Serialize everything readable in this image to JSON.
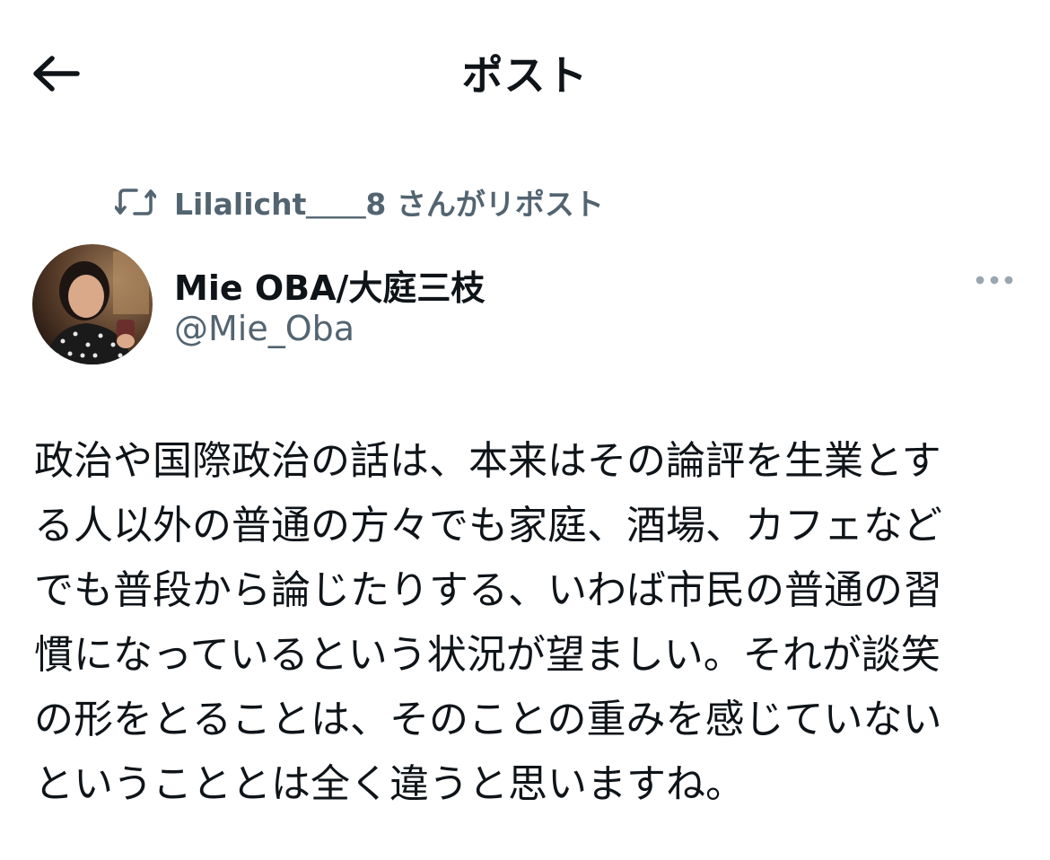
{
  "header": {
    "title": "ポスト",
    "back_icon": "arrow-left-icon"
  },
  "repost": {
    "icon": "repost-icon",
    "text": "Lilalicht＿＿8 さんがリポスト"
  },
  "author": {
    "name": "Mie OBA/大庭三枝",
    "handle": "@Mie_Oba",
    "more_icon": "more-horizontal-icon"
  },
  "post": {
    "text": "政治や国際政治の話は、本来はその論評を生業とす\nる人以外の普通の方々でも家庭、酒場、カフェなど\nでも普段から論じたりする、いわば市民の普通の習\n慣になっているという状況が望ましい。それが談笑\nの形をとることは、そのことの重みを感じていない\nということとは全く違うと思いますね。"
  },
  "colors": {
    "primary_text": "#0f1419",
    "secondary_text": "#536471",
    "background": "#ffffff"
  }
}
